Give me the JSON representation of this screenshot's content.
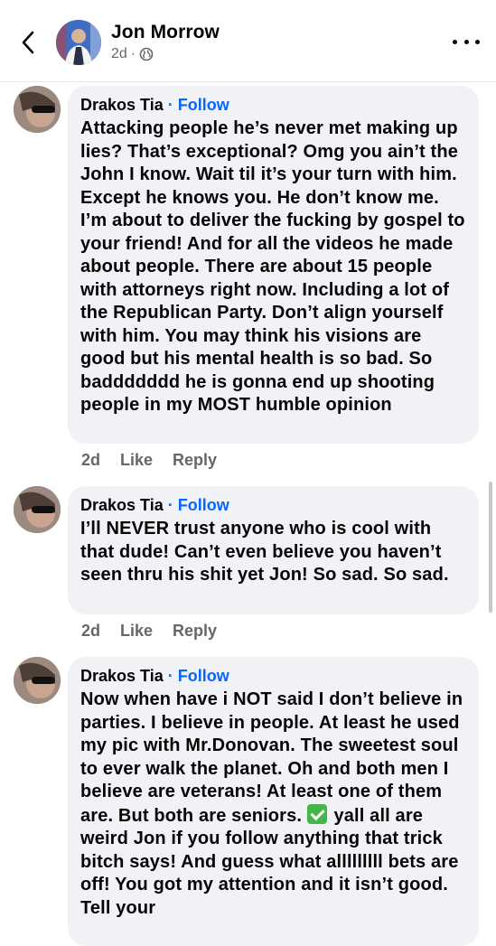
{
  "header": {
    "author": "Jon Morrow",
    "age": "2d",
    "separator": "·",
    "privacy_icon": "globe-icon"
  },
  "comments": [
    {
      "name": "Drakos Tia",
      "dot": "·",
      "follow": "Follow",
      "text": "Attacking people he’s never met making up lies? That’s exceptional? Omg you ain’t the John I know. Wait til it’s your turn with him. Except he knows you. He don’t know me. I’m about to deliver the fucking by gospel to your friend! And for all the videos he made about people. There are about 15 people with attorneys right now. Including a lot of the Republican Party. Don’t align yourself with him. You may think his visions are good but his mental health is so bad. So baddddddd he is gonna end up shooting people in my MOST humble opinion",
      "age": "2d",
      "like": "Like",
      "reply": "Reply"
    },
    {
      "name": "Drakos Tia",
      "dot": "·",
      "follow": "Follow",
      "text": "I’ll NEVER trust anyone who is cool with that dude! Can’t even believe you haven’t seen thru his shit yet Jon! So sad. So sad.",
      "age": "2d",
      "like": "Like",
      "reply": "Reply"
    },
    {
      "name": "Drakos Tia",
      "dot": "·",
      "follow": "Follow",
      "text_before": "Now when have i NOT said I don’t believe in parties. I believe in people. At least he used my pic with Mr.Donovan. The sweetest soul to ever walk the planet. Oh and both men I believe are veterans! At least one of them are. But both are seniors.",
      "text_after": " yall all are weird Jon if you follow anything that trick bitch says! And guess what alllllllll bets are off! You got my attention and it isn’t good. Tell your"
    }
  ]
}
